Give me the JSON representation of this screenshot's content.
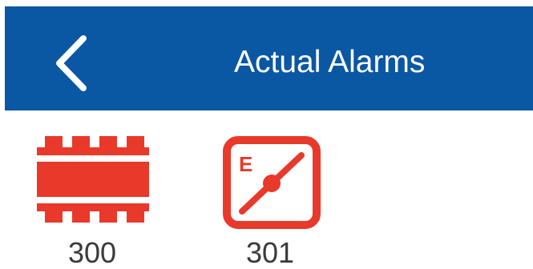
{
  "header": {
    "title": "Actual Alarms",
    "back_icon": "chevron-left-icon",
    "background_color": "#0a57a3",
    "text_color": "#ffffff"
  },
  "alarms": [
    {
      "code": "300",
      "icon": "chip-module-alarm-icon",
      "color": "#e8392b"
    },
    {
      "code": "301",
      "icon": "encoder-shaft-alarm-icon",
      "badge": "E",
      "color": "#e8392b"
    }
  ]
}
